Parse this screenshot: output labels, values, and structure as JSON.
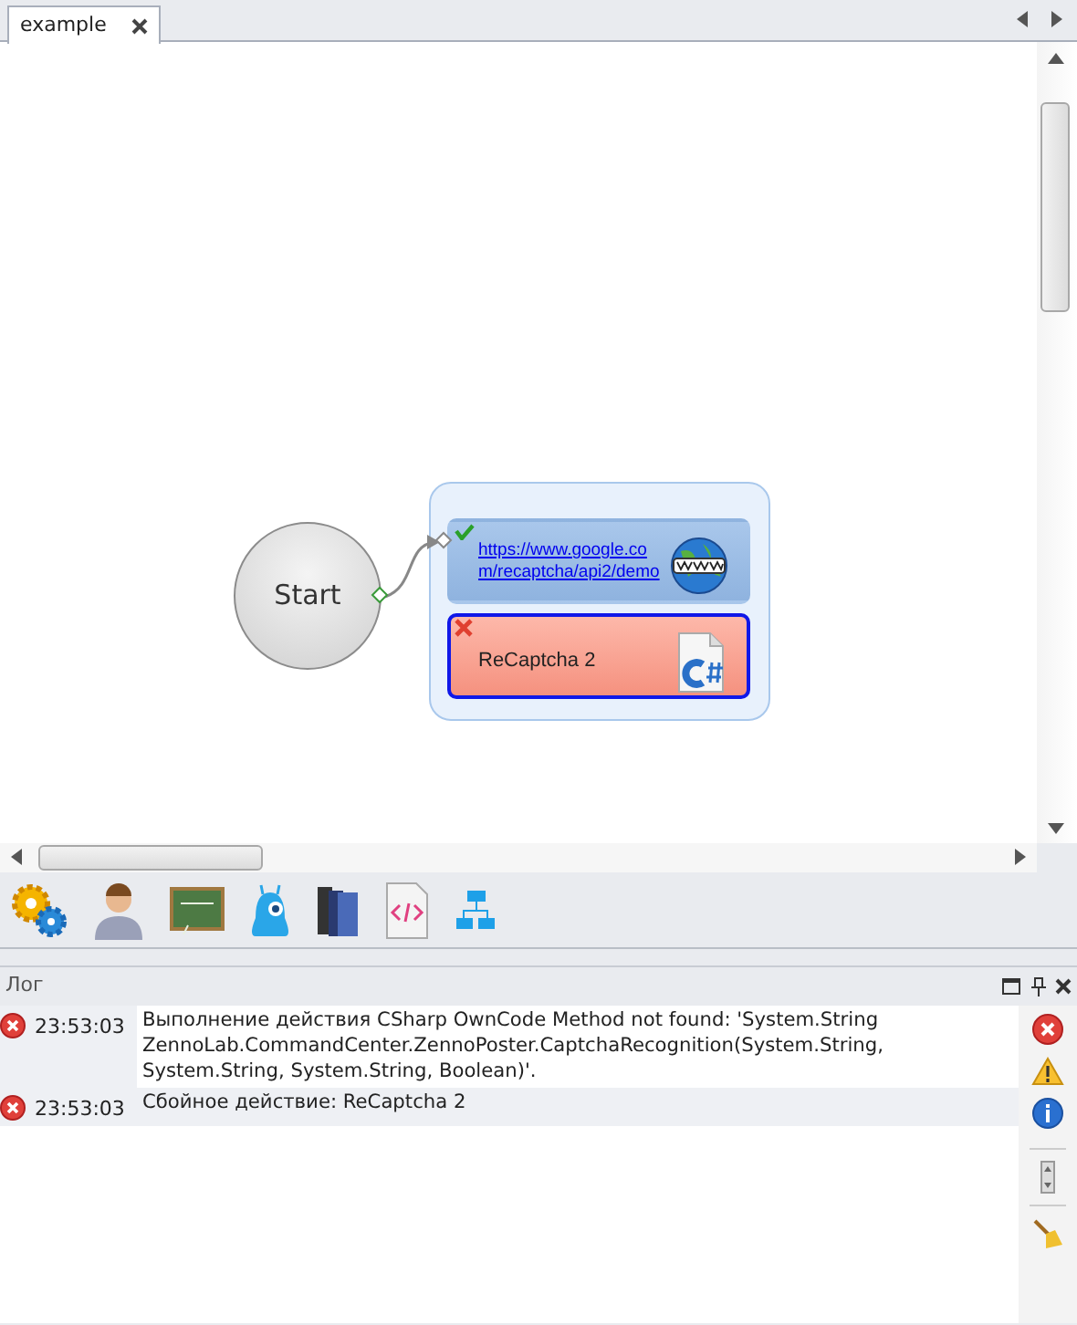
{
  "tabs": [
    {
      "label": "example",
      "selected": true
    }
  ],
  "diagram": {
    "start": {
      "label": "Start"
    },
    "actions": [
      {
        "kind": "url",
        "lines": [
          "https://www.google.co",
          "m/recaptcha/api2/demo"
        ],
        "failed": false,
        "selected": false
      },
      {
        "kind": "code",
        "lines": [
          "ReCaptcha 2"
        ],
        "failed": true,
        "selected": true
      }
    ]
  },
  "log": {
    "title": "Лог",
    "entries": [
      {
        "error": true,
        "time": "23:53:03",
        "message": "Выполнение действия CSharp OwnCode Method not found: 'System.String ZennoLab.CommandCenter.ZennoPoster.CaptchaRecognition(System.String, System.String, System.String, Boolean)'."
      },
      {
        "error": true,
        "time": "23:53:03",
        "message": "Сбойное действие: ReCaptcha 2"
      }
    ]
  }
}
